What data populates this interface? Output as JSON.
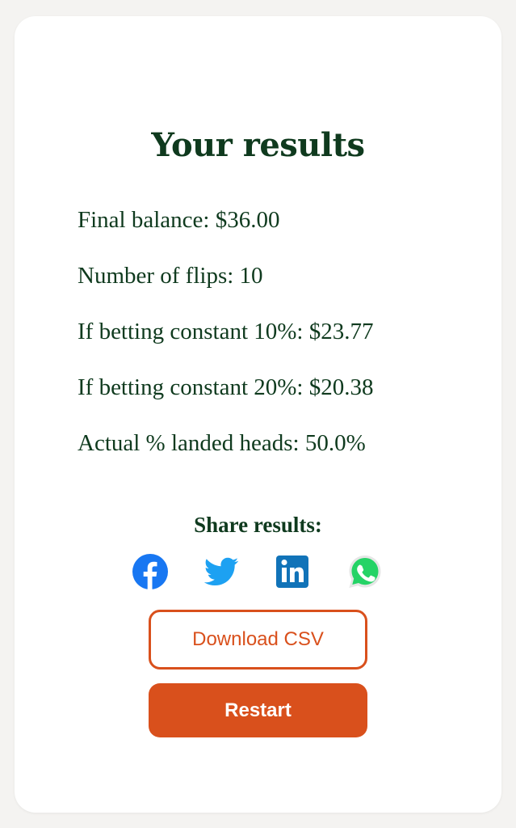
{
  "results": {
    "title": "Your results",
    "stats": [
      "Final balance: $36.00",
      "Number of flips: 10",
      "If betting constant 10%: $23.77",
      "If betting constant 20%: $20.38",
      "Actual % landed heads: 50.0%"
    ]
  },
  "share": {
    "label": "Share results:",
    "icons": [
      "facebook-icon",
      "twitter-icon",
      "linkedin-icon",
      "whatsapp-icon"
    ]
  },
  "buttons": {
    "download_label": "Download CSV",
    "restart_label": "Restart"
  },
  "colors": {
    "text": "#0f3a1e",
    "accent": "#d9501c",
    "facebook": "#1877f2",
    "twitter": "#1da1f2",
    "linkedin": "#0a66c2",
    "whatsapp": "#25d366"
  }
}
